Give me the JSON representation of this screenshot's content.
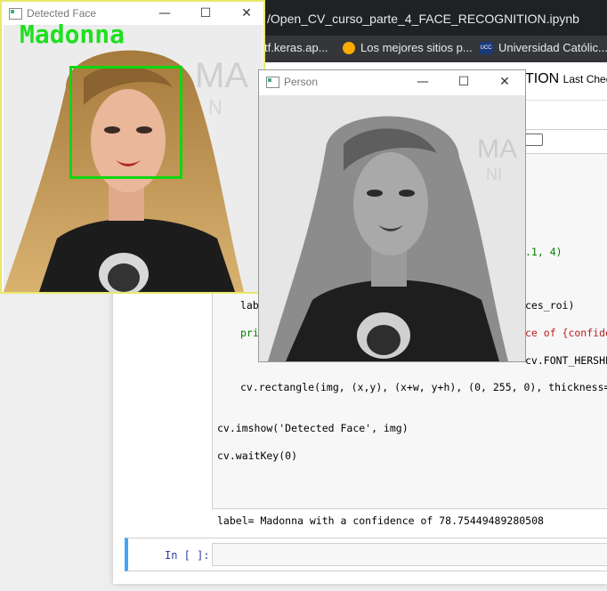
{
  "browser": {
    "url": "/Open_CV_curso_parte_4_FACE_RECOGNITION.ipynb",
    "bookmarks": [
      {
        "label": "tf.keras.ap...",
        "icon": "bookmark-icon"
      },
      {
        "label": "Los mejores sitios p...",
        "icon": "dollar-icon"
      },
      {
        "label": "Universidad Católic...",
        "icon": "ucc-icon"
      }
    ]
  },
  "notebook": {
    "title": "TION",
    "checkpoint": "Last Chec",
    "code_lines": [
      {
        "text": ".1, 4)"
      },
      {
        "text": "lab"
      },
      {
        "text": "ces_roi)"
      },
      {
        "text": "pri"
      },
      {
        "text": "ce of {confide"
      },
      {
        "text": "cv.FONT_HERSHE"
      },
      {
        "text": "cv.rectangle(img, (x,y), (x+w, y+h), (0, 255, 0), thickness="
      },
      {
        "text": "cv.imshow('Detected Face', img)"
      },
      {
        "text": "cv.waitKey(0)"
      }
    ],
    "output": "label= Madonna with a confidence of 78.75449489280508",
    "input_prompt": "In [ ]:"
  },
  "windows": {
    "detected": {
      "title": "Detected Face",
      "label_text": "Madonna"
    },
    "person": {
      "title": "Person"
    },
    "controls": {
      "minimize": "—",
      "maximize": "☐",
      "close": "✕"
    }
  },
  "colors": {
    "detection": "#11d611",
    "label": "#1fe01f"
  }
}
